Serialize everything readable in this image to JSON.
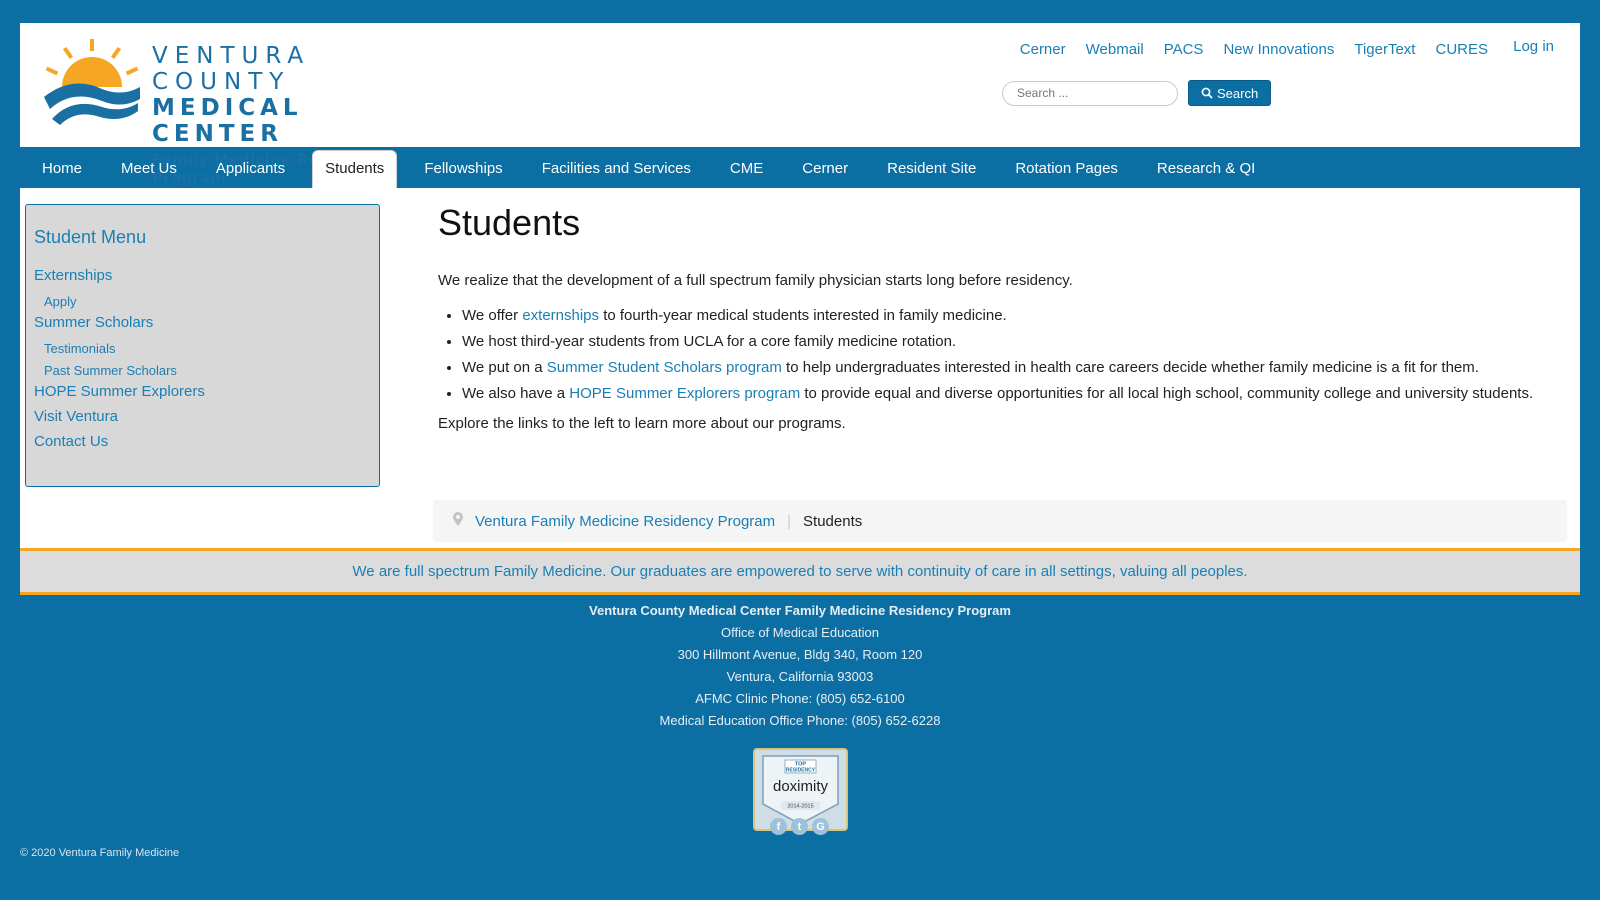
{
  "logo": {
    "line1": "VENTURA COUNTY",
    "line2": "MEDICAL CENTER",
    "line3": "Family Medicine Residency Program"
  },
  "toplinks": [
    "Cerner",
    "Webmail",
    "PACS",
    "New Innovations",
    "TigerText",
    "CURES"
  ],
  "login_label": "Log in",
  "search": {
    "placeholder": "Search ...",
    "button_label": "Search"
  },
  "nav": {
    "items": [
      "Home",
      "Meet Us",
      "Applicants",
      "Students",
      "Fellowships",
      "Facilities and Services",
      "CME",
      "Cerner",
      "Resident Site",
      "Rotation Pages",
      "Research & QI"
    ],
    "active": "Students"
  },
  "sidebar": {
    "title": "Student Menu",
    "items": [
      {
        "label": "Externships",
        "sub": false
      },
      {
        "label": "Apply",
        "sub": true
      },
      {
        "label": "Summer Scholars",
        "sub": false
      },
      {
        "label": "Testimonials",
        "sub": true
      },
      {
        "label": "Past Summer Scholars",
        "sub": true
      },
      {
        "label": "HOPE Summer Explorers",
        "sub": false
      },
      {
        "label": "Visit Ventura",
        "sub": false
      },
      {
        "label": "Contact Us",
        "sub": false
      }
    ]
  },
  "content": {
    "title": "Students",
    "intro": "We realize that the development of a full spectrum family physician starts long before residency.",
    "bullets": [
      {
        "pre": "We offer ",
        "link": "externships",
        "post": " to fourth-year medical students interested in family medicine."
      },
      {
        "pre": "We host third-year students from UCLA for a core family medicine rotation.",
        "link": "",
        "post": ""
      },
      {
        "pre": "We put on a ",
        "link": "Summer Student Scholars program",
        "post": " to help undergraduates interested in health care careers decide whether family medicine is a fit for them."
      },
      {
        "pre": "We also have a ",
        "link": "HOPE Summer Explorers program",
        "post": " to provide equal and diverse opportunities for all local high school, community college and university students."
      }
    ],
    "outro": "Explore the links to the left to learn more about our programs."
  },
  "breadcrumb": {
    "home": "Ventura Family Medicine Residency Program",
    "current": "Students"
  },
  "banner": "We are full spectrum Family Medicine. Our graduates are empowered to serve with continuity of care in all settings, valuing all peoples.",
  "footer": {
    "title": "Ventura County Medical Center Family Medicine Residency Program",
    "lines": [
      "Office of Medical Education",
      "300 Hillmont Avenue, Bldg 340, Room 120",
      "Ventura, California 93003",
      "AFMC Clinic Phone: (805) 652-6100",
      "Medical Education Office Phone: (805) 652-6228"
    ],
    "badge": {
      "top": "TOP",
      "top2": "RESIDENCY",
      "brand": "doximity",
      "years": "2014-2015"
    },
    "social": [
      "f",
      "t",
      "G"
    ],
    "copyright": "© 2020 Ventura Family Medicine"
  },
  "colors": {
    "brand_blue": "#0b6fa4",
    "accent_orange": "#f5a623",
    "link": "#1a7fb5"
  }
}
